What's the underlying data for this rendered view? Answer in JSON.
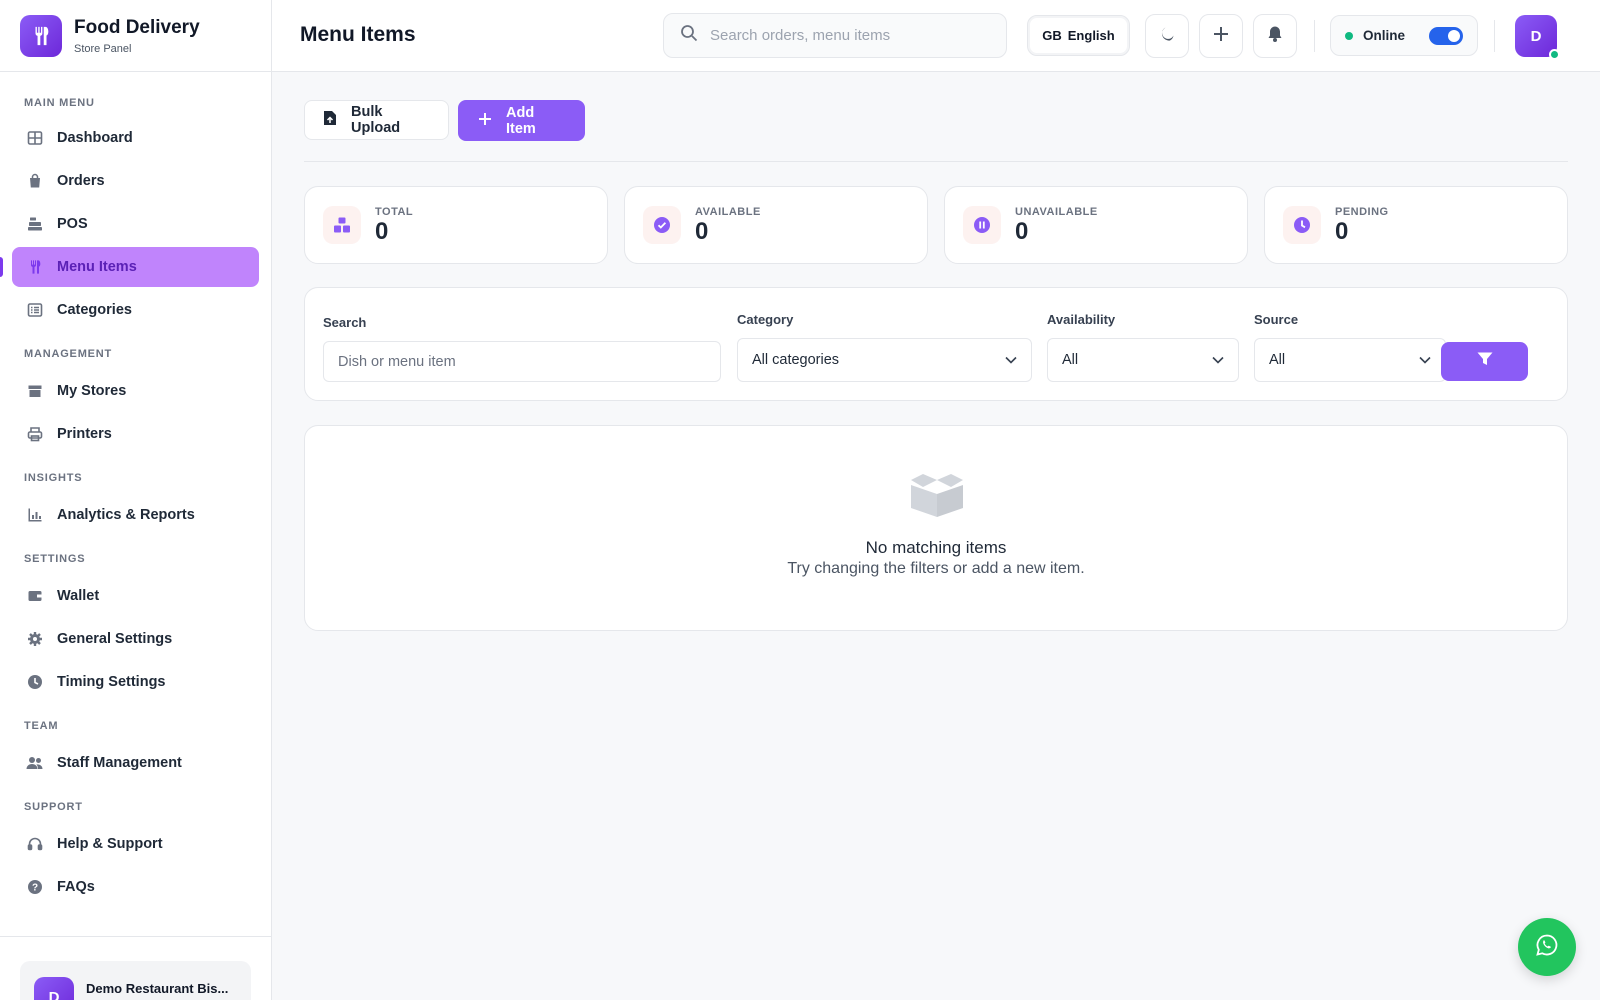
{
  "brand": {
    "title": "Food Delivery",
    "subtitle": "Store Panel",
    "icon": "utensils-icon",
    "accent": "#8b5cf6"
  },
  "sidebar": {
    "sections": [
      {
        "label": "MAIN MENU",
        "items": [
          {
            "label": "Dashboard",
            "icon": "grid-icon"
          },
          {
            "label": "Orders",
            "icon": "bag-icon"
          },
          {
            "label": "POS",
            "icon": "cash-register-icon"
          },
          {
            "label": "Menu Items",
            "icon": "utensils-icon",
            "active": true
          },
          {
            "label": "Categories",
            "icon": "list-icon"
          }
        ]
      },
      {
        "label": "MANAGEMENT",
        "items": [
          {
            "label": "My Stores",
            "icon": "store-icon"
          },
          {
            "label": "Printers",
            "icon": "printer-icon"
          }
        ]
      },
      {
        "label": "INSIGHTS",
        "items": [
          {
            "label": "Analytics & Reports",
            "icon": "chart-icon"
          }
        ]
      },
      {
        "label": "SETTINGS",
        "items": [
          {
            "label": "Wallet",
            "icon": "wallet-icon"
          },
          {
            "label": "General Settings",
            "icon": "gear-icon"
          },
          {
            "label": "Timing Settings",
            "icon": "clock-icon"
          }
        ]
      },
      {
        "label": "TEAM",
        "items": [
          {
            "label": "Staff Management",
            "icon": "users-icon"
          }
        ]
      },
      {
        "label": "SUPPORT",
        "items": [
          {
            "label": "Help & Support",
            "icon": "headset-icon"
          },
          {
            "label": "FAQs",
            "icon": "question-icon"
          }
        ]
      }
    ],
    "store": {
      "initial": "D",
      "name": "Demo Restaurant Bis..."
    }
  },
  "header": {
    "title": "Menu Items",
    "search_placeholder": "Search orders, menu items",
    "lang_code": "GB",
    "lang_label": "English",
    "status_label": "Online",
    "user_initial": "D"
  },
  "actions": {
    "bulk_upload": "Bulk Upload",
    "add_item": "Add Item"
  },
  "stats": [
    {
      "label": "TOTAL",
      "value": "0",
      "icon": "boxes-icon"
    },
    {
      "label": "AVAILABLE",
      "value": "0",
      "icon": "check-circle-icon"
    },
    {
      "label": "UNAVAILABLE",
      "value": "0",
      "icon": "pause-circle-icon"
    },
    {
      "label": "PENDING",
      "value": "0",
      "icon": "clock-icon"
    }
  ],
  "filters": {
    "search_label": "Search",
    "search_placeholder": "Dish or menu item",
    "category_label": "Category",
    "category_value": "All categories",
    "availability_label": "Availability",
    "availability_value": "All",
    "source_label": "Source",
    "source_value": "All"
  },
  "empty": {
    "title": "No matching items",
    "subtitle": "Try changing the filters or add a new item."
  }
}
